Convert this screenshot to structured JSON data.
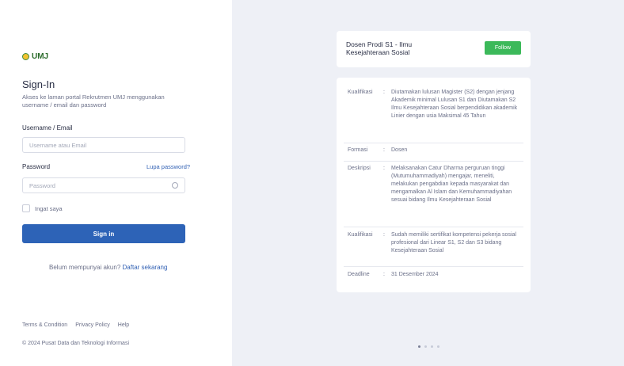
{
  "brand": {
    "logo_text": "UMJ"
  },
  "login": {
    "title": "Sign-In",
    "description": "Akses ke laman portal Rekrutmen UMJ menggunakan username / email dan password",
    "username_label": "Username / Email",
    "username_placeholder": "Username atau Email",
    "password_label": "Password",
    "forgot_link": "Lupa password?",
    "password_placeholder": "Password",
    "remember_label": "Ingat saya",
    "signin_button": "Sign in",
    "register_text": "Belum mempunyai akun?",
    "register_link": "Daftar sekarang"
  },
  "footer": {
    "links": [
      "Terms & Condition",
      "Privacy Policy",
      "Help"
    ],
    "copyright": "© 2024 Pusat Data dan Teknologi Informasi"
  },
  "job": {
    "title": "Dosen Prodi S1 - Ilmu Kesejahteraan Sosial",
    "follow_button": "Follow",
    "rows": [
      {
        "key": "Kualifikasi",
        "value": "Diutamakan lulusan Magister (S2) dengan jenjang Akademik minimal Lulusan S1 dan Diutamakan S2 Ilmu Kesejahteraan Sosial berpendidikan akademik Linier dengan usia Maksimal 45 Tahun"
      },
      {
        "key": "Formasi",
        "value": "Dosen"
      },
      {
        "key": "Deskripsi",
        "value": "Melaksanakan Catur Dharma perguruan tinggi (Mutumuhammadiyah) mengajar, meneliti, melakukan pengabdian kepada masyarakat dan mengamalkan Al Islam dan Kemuhammadiyahan sesuai bidang Ilmu Kesejahteraan Sosial"
      },
      {
        "key": "Kualifikasi",
        "value": "Sudah memiliki sertifikat kompetensi pekerja sosial profesional dari Linear S1, S2 dan S3 bidang Kesejahteraan Sosial"
      },
      {
        "key": "Deadline",
        "value": "31 Desember 2024"
      }
    ]
  },
  "carousel": {
    "count": 4,
    "active": 0
  }
}
